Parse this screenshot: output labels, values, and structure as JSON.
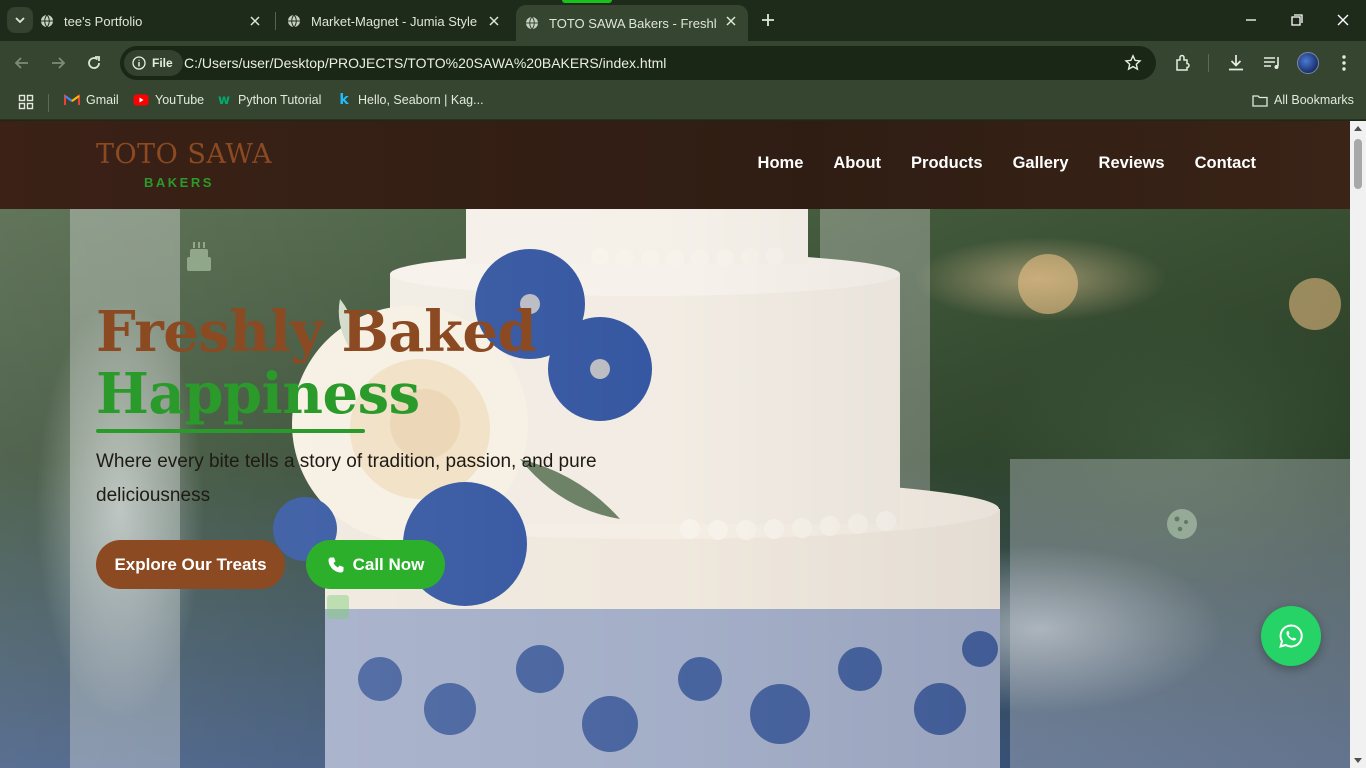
{
  "browser": {
    "tabs": [
      {
        "title": "tee's Portfolio",
        "active": false
      },
      {
        "title": "Market-Magnet - Jumia Style",
        "active": false
      },
      {
        "title": "TOTO SAWA Bakers - Freshly Ba",
        "active": true
      }
    ],
    "address": {
      "scheme_chip": "File",
      "url": "C:/Users/user/Desktop/PROJECTS/TOTO%20SAWA%20BAKERS/index.html"
    },
    "bookmarks": [
      {
        "label": "Gmail",
        "icon": "gmail-icon"
      },
      {
        "label": "YouTube",
        "icon": "youtube-icon"
      },
      {
        "label": "Python Tutorial",
        "icon": "w3schools-icon"
      },
      {
        "label": "Hello, Seaborn | Kag...",
        "icon": "kaggle-icon"
      }
    ],
    "all_bookmarks_label": "All Bookmarks",
    "colors": {
      "frame": "#1e2b1a",
      "toolbar": "#35452f",
      "active_indicator": "#18c21b"
    }
  },
  "site": {
    "logo": {
      "name": "TOTO SAWA",
      "tagline": "BAKERS"
    },
    "nav": [
      "Home",
      "About",
      "Products",
      "Gallery",
      "Reviews",
      "Contact"
    ],
    "hero": {
      "title_line1": "Freshly Baked",
      "title_line2": "Happiness",
      "subtitle": "Where every bite tells a story of tradition, passion, and pure deliciousness",
      "buttons": {
        "explore": "Explore Our Treats",
        "call": "Call Now"
      },
      "decor_icons": [
        "birthday-cake-icon",
        "cookie-icon"
      ]
    },
    "floating_button": "whatsapp-icon",
    "colors": {
      "brand_brown": "#8b4a22",
      "brand_green": "#2a9a2a",
      "call_green": "#2cb02c",
      "whatsapp": "#25d366",
      "header_bg": "#3b2116"
    }
  }
}
